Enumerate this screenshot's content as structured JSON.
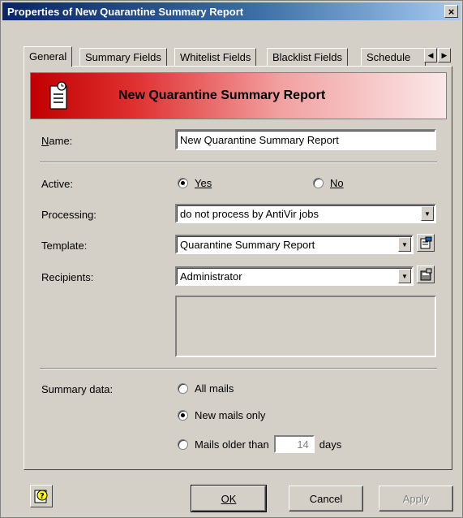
{
  "window": {
    "title": "Properties of New Quarantine Summary Report",
    "close": "×"
  },
  "tabs": [
    {
      "label": "General",
      "active": true
    },
    {
      "label": "Summary Fields"
    },
    {
      "label": "Whitelist Fields"
    },
    {
      "label": "Blacklist Fields"
    },
    {
      "label": "Schedule"
    }
  ],
  "tab_scroll": {
    "left": "◀",
    "right": "▶"
  },
  "banner": {
    "title": "New Quarantine Summary Report",
    "color_start": "#c00000",
    "color_end": "#fbe8e8"
  },
  "form": {
    "name_label": "Name:",
    "name_value": "New Quarantine Summary Report",
    "active_label": "Active:",
    "active_yes": "Yes",
    "active_no": "No",
    "processing_label": "Processing:",
    "processing_value": "do not process by AntiVir jobs",
    "template_label": "Template:",
    "template_value": "Quarantine Summary Report",
    "recipients_label": "Recipients:",
    "recipients_value": "Administrator",
    "summary_label": "Summary data:",
    "summary_all": "All mails",
    "summary_new": "New mails only",
    "summary_older": "Mails older than",
    "summary_days_value": "14",
    "summary_days_unit": "days"
  },
  "buttons": {
    "ok": "OK",
    "cancel": "Cancel",
    "apply": "Apply"
  },
  "icons": {
    "banner": "report-icon",
    "template_props": "properties-icon",
    "recipients_props": "properties-icon",
    "help": "help-icon"
  }
}
